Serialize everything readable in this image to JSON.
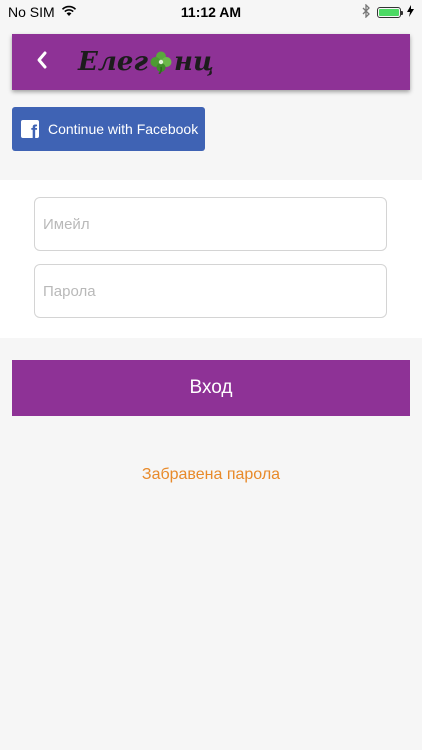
{
  "status_bar": {
    "carrier": "No SIM",
    "time": "11:12 AM",
    "battery_level": 1.0
  },
  "header": {
    "logo_text_left": "Елег",
    "logo_text_right": "нц",
    "back_icon": "chevron-left-icon",
    "background_color": "#8e3296"
  },
  "facebook": {
    "label": "Continue with Facebook",
    "background_color": "#3f63b4"
  },
  "form": {
    "email_placeholder": "Имейл",
    "password_placeholder": "Парола"
  },
  "login": {
    "label": "Вход"
  },
  "forgot_password": {
    "label": "Забравена парола",
    "color": "#e88a2a"
  }
}
